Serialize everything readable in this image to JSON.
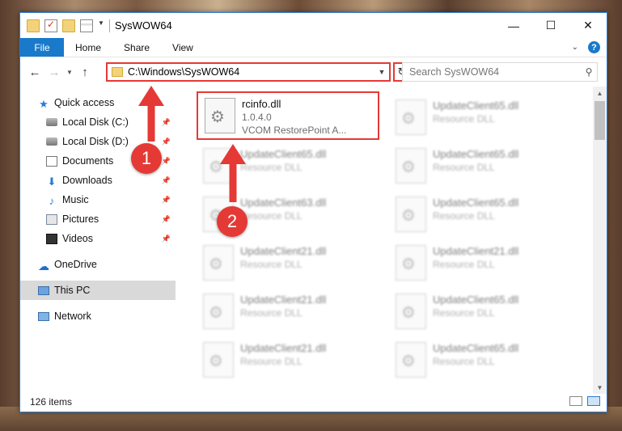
{
  "window": {
    "title": "SysWOW64",
    "controls": {
      "minimize": "—",
      "maximize": "☐",
      "close": "✕"
    }
  },
  "ribbon": {
    "tabs": [
      "File",
      "Home",
      "Share",
      "View"
    ],
    "help": "?"
  },
  "address": {
    "path": "C:\\Windows\\SysWOW64",
    "search_placeholder": "Search SysWOW64"
  },
  "nav_pane": {
    "items": [
      {
        "label": "Quick access",
        "icon": "star-icon",
        "pinned": false
      },
      {
        "label": "Local Disk (C:)",
        "icon": "drive-icon",
        "pinned": true
      },
      {
        "label": "Local Disk (D:)",
        "icon": "drive-icon",
        "pinned": true
      },
      {
        "label": "Documents",
        "icon": "documents-icon",
        "pinned": true
      },
      {
        "label": "Downloads",
        "icon": "download-icon",
        "pinned": true
      },
      {
        "label": "Music",
        "icon": "music-icon",
        "pinned": true
      },
      {
        "label": "Pictures",
        "icon": "pictures-icon",
        "pinned": true
      },
      {
        "label": "Videos",
        "icon": "videos-icon",
        "pinned": true
      },
      {
        "label": "OneDrive",
        "icon": "cloud-icon",
        "pinned": false
      },
      {
        "label": "This PC",
        "icon": "computer-icon",
        "pinned": false,
        "selected": true
      },
      {
        "label": "Network",
        "icon": "network-icon",
        "pinned": false
      }
    ]
  },
  "files": [
    {
      "name": "rcinfo.dll",
      "line2": "1.0.4.0",
      "line3": "VCOM RestorePoint A...",
      "highlighted": true
    },
    {
      "name": "UpdateClient65.dll",
      "line2": "Resource DLL"
    },
    {
      "name": "UpdateClient65.dll",
      "line2": "Resource DLL"
    },
    {
      "name": "UpdateClient65.dll",
      "line2": "Resource DLL"
    },
    {
      "name": "UpdateClient63.dll",
      "line2": "Resource DLL"
    },
    {
      "name": "UpdateClient65.dll",
      "line2": "Resource DLL"
    },
    {
      "name": "UpdateClient21.dll",
      "line2": "Resource DLL"
    },
    {
      "name": "UpdateClient21.dll",
      "line2": "Resource DLL"
    },
    {
      "name": "UpdateClient21.dll",
      "line2": "Resource DLL"
    },
    {
      "name": "UpdateClient65.dll",
      "line2": "Resource DLL"
    },
    {
      "name": "UpdateClient21.dll",
      "line2": "Resource DLL"
    },
    {
      "name": "UpdateClient65.dll",
      "line2": "Resource DLL"
    }
  ],
  "status": {
    "item_count": "126 items"
  },
  "annotations": {
    "step1": "1",
    "step2": "2"
  },
  "colors": {
    "accent": "#1979ca",
    "annotation": "#e53935",
    "selected": "#d9d9d9"
  }
}
